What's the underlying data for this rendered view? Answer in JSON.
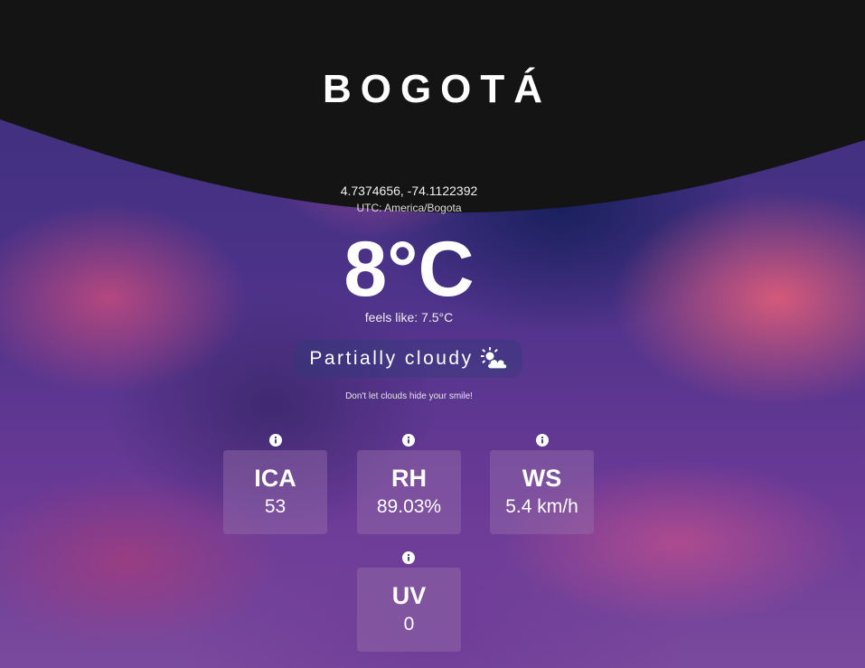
{
  "location": {
    "city": "BOGOTÁ",
    "coordinates": "4.7374656, -74.1122392",
    "timezone": "UTC: America/Bogota"
  },
  "weather": {
    "temperature": "8°C",
    "feels_like": "feels like: 7.5°C",
    "condition": "Partially cloudy",
    "condition_icon": "partly-cloudy-icon",
    "message": "Don't let clouds hide your smile!"
  },
  "metrics": [
    {
      "label": "ICA",
      "value": "53",
      "icon": "info-icon"
    },
    {
      "label": "RH",
      "value": "89.03%",
      "icon": "info-icon"
    },
    {
      "label": "WS",
      "value": "5.4 km/h",
      "icon": "info-icon"
    },
    {
      "label": "UV",
      "value": "0",
      "icon": "info-icon"
    }
  ],
  "colors": {
    "header": "#141414",
    "card": "#7a5a96",
    "condition_pill": "#2e3f78"
  }
}
